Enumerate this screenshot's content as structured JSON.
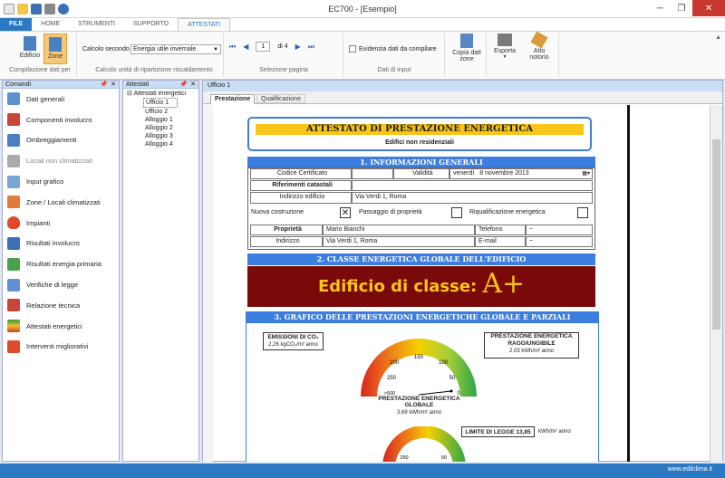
{
  "window": {
    "title": "EC700 - [Esempio]",
    "close": "✕",
    "minimize": "─",
    "restore": "❐"
  },
  "ribbon_tabs": [
    "FILE",
    "HOME",
    "STRUMENTI",
    "SUPPORTO",
    "ATTESTATI"
  ],
  "ribbon": {
    "edificio": "Edificio",
    "zone": "Zone",
    "group1_label": "Compilazione dati per",
    "calcolo_label": "Calcolo secondo",
    "calcolo_value": "Energia utile invernale",
    "group2_label": "Calcolo unità di ripartizione riscaldamento",
    "page_value": "1",
    "page_of": "di 4",
    "group3_label": "Selezione pagina",
    "evidenzia_label": "Evidenzia dati da compilare",
    "group4_label": "Dati di input",
    "copia_label1": "Copia dati",
    "copia_label2": "zone",
    "esporta_label": "Esporta",
    "atto_label1": "Atto",
    "atto_label2": "notorio"
  },
  "comandi": {
    "title": "Comandi",
    "items": [
      "Dati generali",
      "Componenti involucro",
      "Ombreggiamenti",
      "Locali non climatizzati",
      "Input grafico",
      "Zone / Locali climatizzati",
      "Impianti",
      "Risultati involucro",
      "Risultati energia primaria",
      "Verifiche di legge",
      "Relazione tecnica",
      "Attestati energetici",
      "Interventi migliorativi"
    ]
  },
  "attestati": {
    "title": "Attestati",
    "root": "Attestati energetici",
    "children": [
      "Ufficio 1",
      "Ufficio 2",
      "Alloggio 1",
      "Alloggio 2",
      "Alloggio 3",
      "Alloggio 4"
    ]
  },
  "doc": {
    "tab_title": "Ufficio 1",
    "subtabs": [
      "Prestazione",
      "Qualificazione"
    ],
    "main_title": "ATTESTATO DI PRESTAZIONE ENERGETICA",
    "subtitle": "Edifici non residenziali",
    "sec1": "1. INFORMAZIONI GENERALI",
    "codice_label": "Codice Certificato",
    "validita_label": "Validità",
    "validita_day": "venerdì",
    "validita_date": "8 novembre 2013",
    "riferimenti_label": "Riferimenti catastali",
    "indirizzo_edificio_label": "Indirizzo edificio",
    "indirizzo_edificio": "Via Verdi 1, Roma",
    "nuova_costruzione": "Nuova costruzione",
    "passaggio": "Passaggio di proprietà",
    "riqualificazione": "Riqualificazione energetica",
    "check_mark": "✕",
    "proprieta_label": "Proprietà",
    "proprieta": "Mario Bianchi",
    "telefono_label": "Telefono",
    "telefono": "~",
    "indirizzo_label": "Indirizzo",
    "indirizzo": "Via Verdi 1, Roma",
    "email_label": "E-mail",
    "email": "~",
    "sec2": "2. CLASSE ENERGETICA GLOBALE DELL'EDIFICIO",
    "classe_text": "Edificio di classe:",
    "classe_value": "A+",
    "sec3": "3. GRAFICO DELLE PRESTAZIONI ENERGETICHE GLOBALE E PARZIALI",
    "emissioni_title": "EMISSIONI DI CO₂",
    "emissioni_value": "2,26 kgCO₂/m² anno",
    "prest_raggiungibile_title1": "PRESTAZIONE ENERGETICA",
    "prest_raggiungibile_title2": "RAGGIUNGIBILE",
    "prest_raggiungibile_value": "2,03 kWh/m² anno",
    "gauge_ticks": [
      "150",
      "200",
      "100",
      "250",
      "50",
      ">500",
      "0"
    ],
    "prest_globale_title1": "PRESTAZIONE ENERGETICA",
    "prest_globale_title2": "GLOBALE",
    "prest_globale_value": "3,69 kWh/m² anno",
    "limite_label": "LIMITE DI LEGGE 13,85",
    "limite_unit": "kWh/m² anno",
    "gauge2_ticks": [
      "250",
      "50"
    ]
  },
  "status": {
    "url": "www.edilclima.it"
  }
}
